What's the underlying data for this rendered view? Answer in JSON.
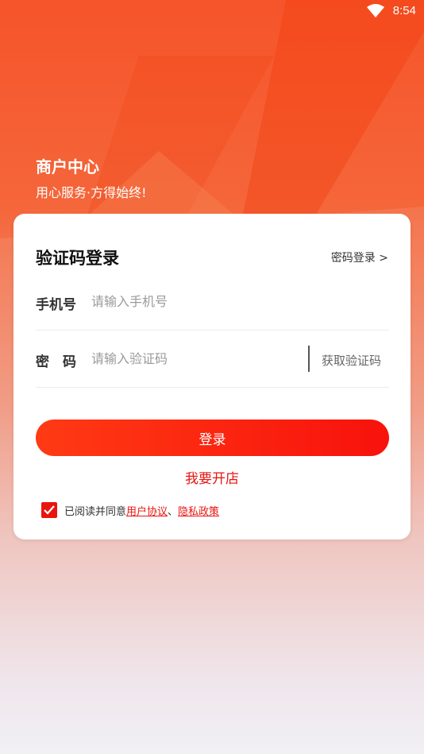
{
  "status_bar": {
    "time": "8:54"
  },
  "hero": {
    "title": "商户中心",
    "subtitle": "用心服务·方得始终!"
  },
  "login": {
    "title": "验证码登录",
    "switch_link": "密码登录 >",
    "phone_label": "手机号",
    "phone_placeholder": "请输入手机号",
    "code_label": "密　码",
    "code_placeholder": "请输入验证码",
    "get_code": "获取验证码",
    "submit": "登录",
    "open_store": "我要开店"
  },
  "agreement": {
    "checked": true,
    "prefix": "已阅读并同意",
    "user_agreement": "用户协议",
    "separator": "、",
    "privacy_policy": "隐私政策"
  },
  "colors": {
    "accent": "#e8150f",
    "brand_gradient_start": "#f6542a"
  }
}
